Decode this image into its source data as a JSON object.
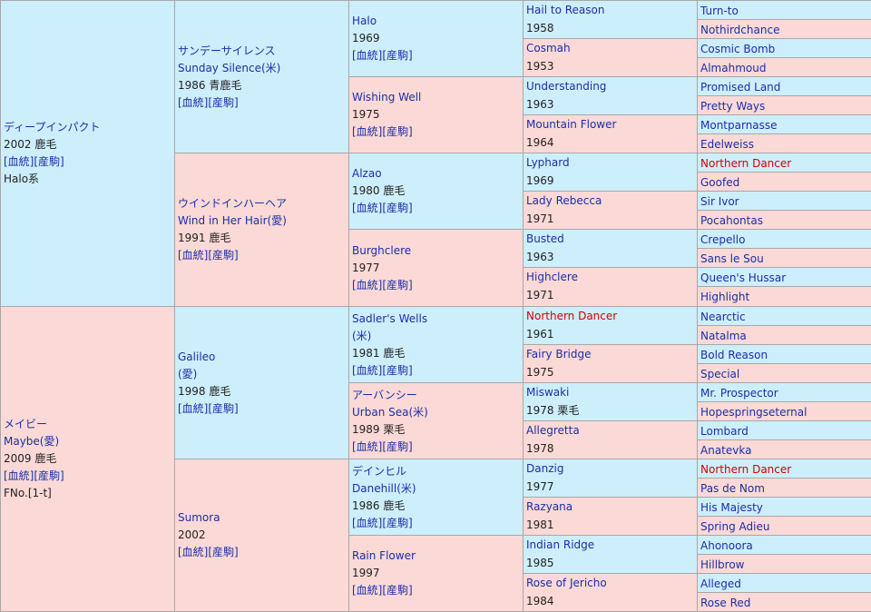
{
  "gen1": [
    {
      "lines": [
        {
          "text": "ディープインパクト",
          "kind": "name"
        },
        {
          "text": "2002 鹿毛",
          "kind": "meta"
        },
        {
          "text": "[血統][産駒]",
          "kind": "link"
        },
        {
          "text": "Halo系",
          "kind": "meta"
        }
      ]
    },
    {
      "lines": [
        {
          "text": "メイビー",
          "kind": "name"
        },
        {
          "text": "Maybe(愛)",
          "kind": "name"
        },
        {
          "text": "2009 鹿毛",
          "kind": "meta"
        },
        {
          "text": "[血統][産駒]",
          "kind": "link"
        },
        {
          "text": "FNo.[1-t]",
          "kind": "meta"
        }
      ]
    }
  ],
  "gen2": [
    {
      "lines": [
        {
          "text": "サンデーサイレンス",
          "kind": "name"
        },
        {
          "text": "Sunday Silence(米)",
          "kind": "name"
        },
        {
          "text": "1986 青鹿毛",
          "kind": "meta"
        },
        {
          "text": "[血統][産駒]",
          "kind": "link"
        }
      ]
    },
    {
      "lines": [
        {
          "text": "ウインドインハーヘア",
          "kind": "name"
        },
        {
          "text": "Wind in Her Hair(愛)",
          "kind": "name"
        },
        {
          "text": "1991 鹿毛",
          "kind": "meta"
        },
        {
          "text": "[血統][産駒]",
          "kind": "link"
        }
      ]
    },
    {
      "lines": [
        {
          "text": "Galileo",
          "kind": "name"
        },
        {
          "text": "(愛)",
          "kind": "name"
        },
        {
          "text": "1998 鹿毛",
          "kind": "meta"
        },
        {
          "text": "[血統][産駒]",
          "kind": "link"
        }
      ]
    },
    {
      "lines": [
        {
          "text": "Sumora",
          "kind": "name"
        },
        {
          "text": "2002",
          "kind": "meta"
        },
        {
          "text": "[血統][産駒]",
          "kind": "link"
        }
      ]
    }
  ],
  "gen3": [
    {
      "lines": [
        {
          "text": "Halo",
          "kind": "name"
        },
        {
          "text": "1969",
          "kind": "meta"
        },
        {
          "text": "[血統][産駒]",
          "kind": "link"
        }
      ]
    },
    {
      "lines": [
        {
          "text": "Wishing Well",
          "kind": "name"
        },
        {
          "text": "1975",
          "kind": "meta"
        },
        {
          "text": "[血統][産駒]",
          "kind": "link"
        }
      ]
    },
    {
      "lines": [
        {
          "text": "Alzao",
          "kind": "name"
        },
        {
          "text": "1980 鹿毛",
          "kind": "meta"
        },
        {
          "text": "[血統][産駒]",
          "kind": "link"
        }
      ]
    },
    {
      "lines": [
        {
          "text": "Burghclere",
          "kind": "name"
        },
        {
          "text": "1977",
          "kind": "meta"
        },
        {
          "text": "[血統][産駒]",
          "kind": "link"
        }
      ]
    },
    {
      "lines": [
        {
          "text": "Sadler's Wells",
          "kind": "name"
        },
        {
          "text": "(米)",
          "kind": "name"
        },
        {
          "text": "1981 鹿毛",
          "kind": "meta"
        },
        {
          "text": "[血統][産駒]",
          "kind": "link"
        }
      ]
    },
    {
      "lines": [
        {
          "text": "アーバンシー",
          "kind": "name"
        },
        {
          "text": "Urban Sea(米)",
          "kind": "name"
        },
        {
          "text": "1989 栗毛",
          "kind": "meta"
        },
        {
          "text": "[血統][産駒]",
          "kind": "link"
        }
      ]
    },
    {
      "lines": [
        {
          "text": "デインヒル",
          "kind": "name"
        },
        {
          "text": "Danehill(米)",
          "kind": "name"
        },
        {
          "text": "1986 鹿毛",
          "kind": "meta"
        },
        {
          "text": "[血統][産駒]",
          "kind": "link"
        }
      ]
    },
    {
      "lines": [
        {
          "text": "Rain Flower",
          "kind": "name"
        },
        {
          "text": "1997",
          "kind": "meta"
        },
        {
          "text": "[血統][産駒]",
          "kind": "link"
        }
      ]
    }
  ],
  "gen4": [
    {
      "lines": [
        {
          "text": "Hail to Reason",
          "kind": "name"
        },
        {
          "text": "1958",
          "kind": "meta"
        }
      ]
    },
    {
      "lines": [
        {
          "text": "Cosmah",
          "kind": "name"
        },
        {
          "text": "1953",
          "kind": "meta"
        }
      ]
    },
    {
      "lines": [
        {
          "text": "Understanding",
          "kind": "name"
        },
        {
          "text": "1963",
          "kind": "meta"
        }
      ]
    },
    {
      "lines": [
        {
          "text": "Mountain Flower",
          "kind": "name"
        },
        {
          "text": "1964",
          "kind": "meta"
        }
      ]
    },
    {
      "lines": [
        {
          "text": "Lyphard",
          "kind": "name"
        },
        {
          "text": "1969",
          "kind": "meta"
        }
      ]
    },
    {
      "lines": [
        {
          "text": "Lady Rebecca",
          "kind": "name"
        },
        {
          "text": "1971",
          "kind": "meta"
        }
      ]
    },
    {
      "lines": [
        {
          "text": "Busted",
          "kind": "name"
        },
        {
          "text": "1963",
          "kind": "meta"
        }
      ]
    },
    {
      "lines": [
        {
          "text": "Highclere",
          "kind": "name"
        },
        {
          "text": "1971",
          "kind": "meta"
        }
      ]
    },
    {
      "lines": [
        {
          "text": "Northern Dancer",
          "kind": "name",
          "red": true
        },
        {
          "text": "1961",
          "kind": "meta"
        }
      ]
    },
    {
      "lines": [
        {
          "text": "Fairy Bridge",
          "kind": "name"
        },
        {
          "text": "1975",
          "kind": "meta"
        }
      ]
    },
    {
      "lines": [
        {
          "text": "Miswaki",
          "kind": "name"
        },
        {
          "text": "1978 栗毛",
          "kind": "meta"
        }
      ]
    },
    {
      "lines": [
        {
          "text": "Allegretta",
          "kind": "name"
        },
        {
          "text": "1978",
          "kind": "meta"
        }
      ]
    },
    {
      "lines": [
        {
          "text": "Danzig",
          "kind": "name"
        },
        {
          "text": "1977",
          "kind": "meta"
        }
      ]
    },
    {
      "lines": [
        {
          "text": "Razyana",
          "kind": "name"
        },
        {
          "text": "1981",
          "kind": "meta"
        }
      ]
    },
    {
      "lines": [
        {
          "text": "Indian Ridge",
          "kind": "name"
        },
        {
          "text": "1985",
          "kind": "meta"
        }
      ]
    },
    {
      "lines": [
        {
          "text": "Rose of Jericho",
          "kind": "name"
        },
        {
          "text": "1984",
          "kind": "meta"
        }
      ]
    }
  ],
  "gen5": [
    {
      "name": "Turn-to"
    },
    {
      "name": "Nothirdchance"
    },
    {
      "name": "Cosmic Bomb"
    },
    {
      "name": "Almahmoud"
    },
    {
      "name": "Promised Land"
    },
    {
      "name": "Pretty Ways"
    },
    {
      "name": "Montparnasse"
    },
    {
      "name": "Edelweiss"
    },
    {
      "name": "Northern Dancer",
      "red": true
    },
    {
      "name": "Goofed"
    },
    {
      "name": "Sir Ivor"
    },
    {
      "name": "Pocahontas"
    },
    {
      "name": "Crepello"
    },
    {
      "name": "Sans le Sou"
    },
    {
      "name": "Queen's Hussar"
    },
    {
      "name": "Highlight"
    },
    {
      "name": "Nearctic"
    },
    {
      "name": "Natalma"
    },
    {
      "name": "Bold Reason"
    },
    {
      "name": "Special"
    },
    {
      "name": "Mr. Prospector"
    },
    {
      "name": "Hopespringseternal"
    },
    {
      "name": "Lombard"
    },
    {
      "name": "Anatevka"
    },
    {
      "name": "Northern Dancer",
      "red": true
    },
    {
      "name": "Pas de Nom"
    },
    {
      "name": "His Majesty"
    },
    {
      "name": "Spring Adieu"
    },
    {
      "name": "Ahonoora"
    },
    {
      "name": "Hillbrow"
    },
    {
      "name": "Alleged"
    },
    {
      "name": "Rose Red"
    }
  ],
  "colors": {
    "sire_bg": "#cdeefb",
    "dam_bg": "#fbd9d6",
    "border": "#a8a8a8",
    "name": "#1a2fa8",
    "highlight": "#d60000"
  }
}
